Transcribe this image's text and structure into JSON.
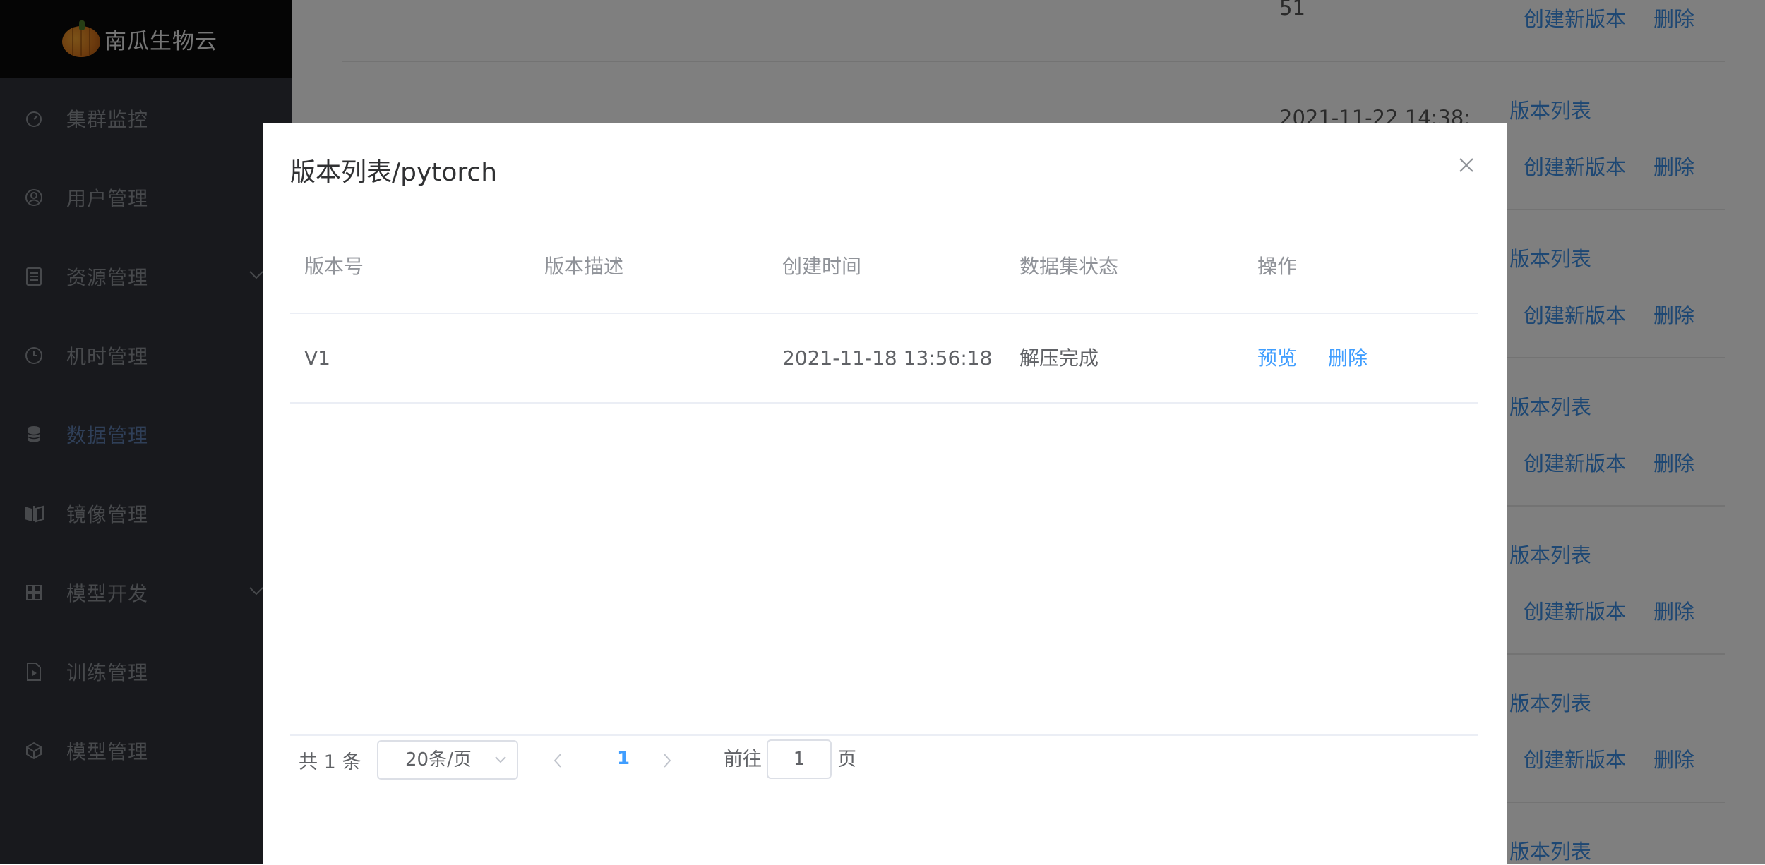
{
  "app": {
    "name": "南瓜生物云"
  },
  "sidebar": {
    "items": [
      {
        "label": "集群监控",
        "icon": "dashboard-icon"
      },
      {
        "label": "用户管理",
        "icon": "user-icon"
      },
      {
        "label": "资源管理",
        "icon": "document-icon",
        "expandable": true
      },
      {
        "label": "机时管理",
        "icon": "clock-icon"
      },
      {
        "label": "数据管理",
        "icon": "database-icon",
        "active": true
      },
      {
        "label": "镜像管理",
        "icon": "mirror-icon"
      },
      {
        "label": "模型开发",
        "icon": "grid-icon",
        "expandable": true
      },
      {
        "label": "训练管理",
        "icon": "file-play-icon"
      },
      {
        "label": "模型管理",
        "icon": "cube-icon"
      }
    ]
  },
  "background": {
    "partial_values": [
      "51",
      "2021-11-22 14:38:"
    ],
    "links": {
      "version_list": "版本列表",
      "create_version": "创建新版本",
      "delete": "删除"
    }
  },
  "dialog": {
    "title": "版本列表/pytorch",
    "columns": [
      "版本号",
      "版本描述",
      "创建时间",
      "数据集状态",
      "操作"
    ],
    "rows": [
      {
        "version": "V1",
        "description": "",
        "created_at": "2021-11-18 13:56:18",
        "status": "解压完成",
        "actions": [
          "预览",
          "删除"
        ]
      }
    ],
    "pagination": {
      "total_text": "共 1 条",
      "page_size": "20条/页",
      "current_page": "1",
      "goto_label": "前往",
      "goto_value": "1",
      "goto_unit": "页"
    }
  },
  "colors": {
    "accent": "#409eff",
    "sidebar_bg": "#30333a",
    "logo_bg": "#0a0a0a",
    "active_menu": "#5f7fb0"
  }
}
